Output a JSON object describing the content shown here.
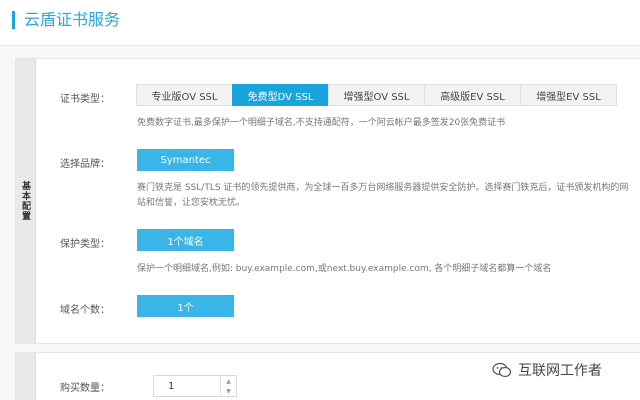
{
  "header": {
    "title": "云盾证书服务"
  },
  "section1": {
    "side_label": "基本配置",
    "cert_type": {
      "label": "证书类型：",
      "tabs": [
        "专业版OV SSL",
        "免费型DV SSL",
        "增强型OV SSL",
        "高级版EV SSL",
        "增强型EV SSL"
      ],
      "selected": "免费型DV SSL",
      "desc": "免费数字证书,最多保护一个明细子域名,不支持通配符，一个阿云帐户最多签发20张免费证书"
    },
    "brand": {
      "label": "选择品牌：",
      "value": "Symantec",
      "desc": "赛门铁克是 SSL/TLS 证书的领先提供商，为全球一百多万台网络服务器提供安全防护。选择赛门铁克后，证书颁发机构的网站和信誉，让您安枕无忧。"
    },
    "protect": {
      "label": "保护类型：",
      "value": "1个域名",
      "desc": "保护一个明细域名,例如: buy.example.com,或next.buy.example.com, 各个明细子域名都算一个域名"
    },
    "domain_count": {
      "label": "域名个数：",
      "value": "1个"
    }
  },
  "section2": {
    "qty_label": "购买数量：",
    "qty_value": "1"
  },
  "watermark": {
    "text": "互联网工作者"
  },
  "colors": {
    "accent": "#19a4de",
    "button": "#39b5e8"
  }
}
